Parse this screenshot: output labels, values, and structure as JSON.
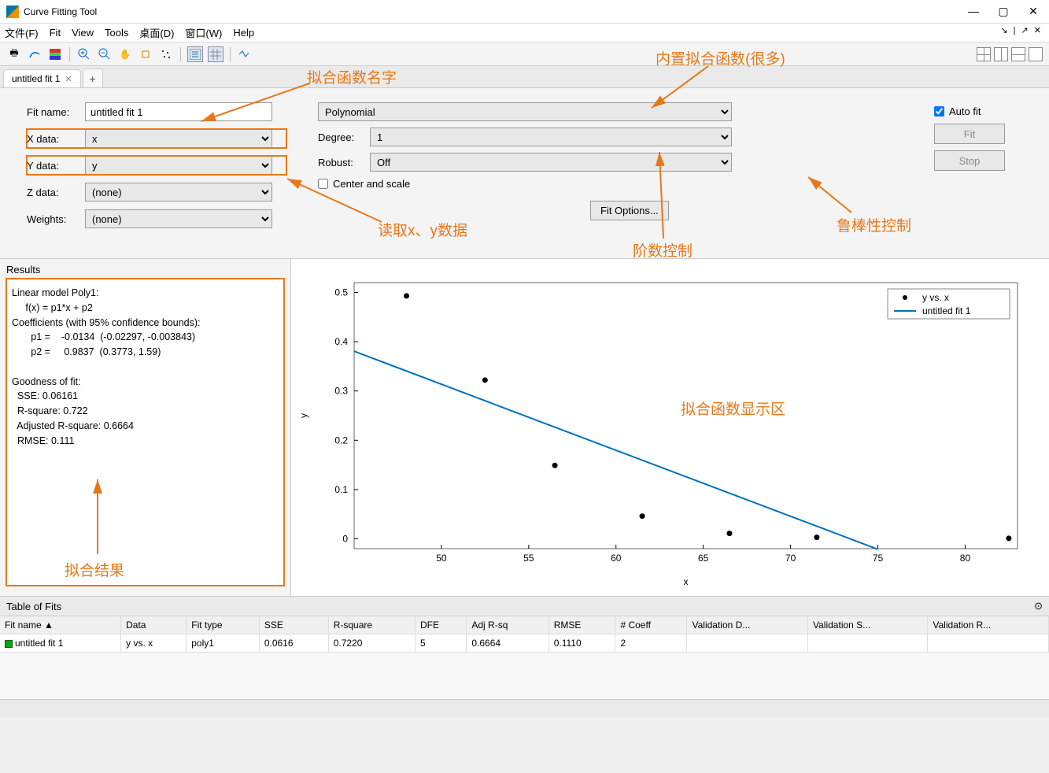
{
  "window": {
    "title": "Curve Fitting Tool"
  },
  "menu": [
    "文件(F)",
    "Fit",
    "View",
    "Tools",
    "桌面(D)",
    "窗口(W)",
    "Help"
  ],
  "tabs": [
    {
      "label": "untitled fit 1"
    }
  ],
  "form": {
    "fit_name_label": "Fit name:",
    "fit_name_value": "untitled fit 1",
    "x_label": "X data:",
    "x_value": "x",
    "y_label": "Y data:",
    "y_value": "y",
    "z_label": "Z data:",
    "z_value": "(none)",
    "w_label": "Weights:",
    "w_value": "(none)"
  },
  "fittype": {
    "type_value": "Polynomial",
    "degree_label": "Degree:",
    "degree_value": "1",
    "robust_label": "Robust:",
    "robust_value": "Off",
    "center_label": "Center and scale",
    "fitopts_label": "Fit Options..."
  },
  "actions": {
    "autofit_label": "Auto fit",
    "fit_label": "Fit",
    "stop_label": "Stop"
  },
  "results": {
    "header": "Results",
    "text": "Linear model Poly1:\n     f(x) = p1*x + p2\nCoefficients (with 95% confidence bounds):\n       p1 =    -0.0134  (-0.02297, -0.003843)\n       p2 =     0.9837  (0.3773, 1.59)\n\nGoodness of fit:\n  SSE: 0.06161\n  R-square: 0.722\n  Adjusted R-square: 0.6664\n  RMSE: 0.111"
  },
  "tof": {
    "header": "Table of Fits",
    "cols": [
      "Fit name ▲",
      "Data",
      "Fit type",
      "SSE",
      "R-square",
      "DFE",
      "Adj R-sq",
      "RMSE",
      "# Coeff",
      "Validation D...",
      "Validation S...",
      "Validation R..."
    ],
    "row": [
      "untitled fit 1",
      "y vs. x",
      "poly1",
      "0.0616",
      "0.7220",
      "5",
      "0.6664",
      "0.1110",
      "2",
      "",
      "",
      ""
    ]
  },
  "annotations": {
    "fit_name": "拟合函数名字",
    "builtin": "内置拟合函数(很多)",
    "read_xy": "读取x、y数据",
    "degree": "阶数控制",
    "robust": "鲁棒性控制",
    "display": "拟合函数显示区",
    "result": "拟合结果"
  },
  "chart_data": {
    "type": "scatter+line",
    "title": "",
    "xlabel": "x",
    "ylabel": "y",
    "xlim": [
      45,
      83
    ],
    "ylim": [
      -0.02,
      0.52
    ],
    "xticks": [
      50,
      55,
      60,
      65,
      70,
      75,
      80
    ],
    "yticks": [
      0,
      0.1,
      0.2,
      0.3,
      0.4,
      0.5
    ],
    "scatter": {
      "name": "y vs. x",
      "x": [
        48,
        52.5,
        56.5,
        61.5,
        66.5,
        71.5,
        82.5
      ],
      "y": [
        0.493,
        0.322,
        0.149,
        0.046,
        0.011,
        0.003,
        0.001
      ]
    },
    "line": {
      "name": "untitled fit 1",
      "p1": -0.0134,
      "p2": 0.9837,
      "x_range": [
        45,
        75
      ]
    },
    "legend": [
      "y vs. x",
      "untitled fit 1"
    ]
  }
}
